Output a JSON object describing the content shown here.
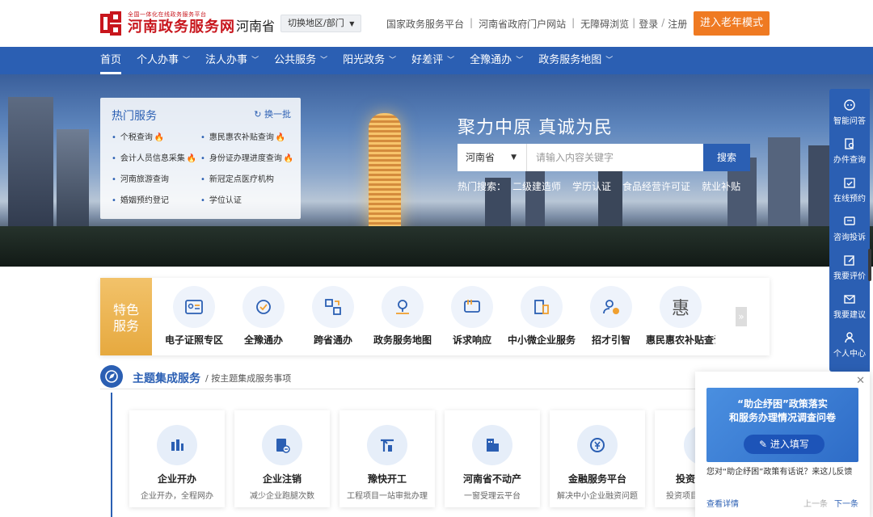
{
  "header": {
    "logo_sub": "全国一体化在线政务服务平台",
    "logo_main": "河南政务服务网",
    "region": "河南省",
    "switch_label": "切换地区/部门",
    "links": [
      "国家政务服务平台",
      "河南省政府门户网站",
      "无障碍浏览"
    ],
    "login": "登录",
    "register": "注册",
    "elder_mode": "进入老年模式"
  },
  "nav": {
    "items": [
      "首页",
      "个人办事",
      "法人办事",
      "公共服务",
      "阳光政务",
      "好差评",
      "全豫通办",
      "政务服务地图"
    ]
  },
  "hot": {
    "title": "热门服务",
    "refresh": "换一批",
    "items": [
      "个税查询",
      "惠民惠农补贴查询",
      "会计人员信息采集",
      "身份证办理进度查询",
      "河南旅游查询",
      "新冠定点医疗机构",
      "婚姻预约登记",
      "学位认证"
    ]
  },
  "banner": {
    "slogan": "聚力中原  真诚为民",
    "search_region": "河南省",
    "search_placeholder": "请输入内容关键字",
    "search_button": "搜索",
    "hot_label": "热门搜索：",
    "hot_terms": [
      "二级建造师",
      "学历认证",
      "食品经营许可证",
      "就业补贴"
    ]
  },
  "sidebar": {
    "items": [
      "智能问答",
      "办件查询",
      "在线预约",
      "咨询投诉",
      "我要评价",
      "我要建议",
      "个人中心"
    ]
  },
  "feature": {
    "tag_line1": "特色",
    "tag_line2": "服务",
    "items": [
      "电子证照专区",
      "全豫通办",
      "跨省通办",
      "政务服务地图",
      "诉求响应",
      "中小微企业服务",
      "招才引智",
      "惠民惠农补贴查询"
    ],
    "more": "»"
  },
  "theme": {
    "title": "主题集成服务",
    "subtitle": "/ 按主题集成服务事项",
    "cards": [
      {
        "title": "企业开办",
        "desc": "企业开办，全程网办"
      },
      {
        "title": "企业注销",
        "desc": "减少企业跑腿次数"
      },
      {
        "title": "豫快开工",
        "desc": "工程项目一站审批办理"
      },
      {
        "title": "河南省不动产",
        "desc": "一窗受理云平台"
      },
      {
        "title": "金融服务平台",
        "desc": "解决中小企业融资问题"
      },
      {
        "title": "投资",
        "desc": "投资项目"
      }
    ]
  },
  "popup": {
    "close": "✕",
    "banner_title_1": "“助企纾困”政策落实",
    "banner_title_2": "和服务办理情况调查问卷",
    "fill_button": "进入填写",
    "text": "您对“助企纾困”政策有话说？来这儿反馈",
    "detail": "查看详情",
    "prev": "上一条",
    "next": "下一条"
  },
  "colors": {
    "brand_blue": "#2b5fb3",
    "brand_red": "#c8161d",
    "accent_orange": "#ef7a22",
    "feature_gold": "#e6a93f"
  }
}
